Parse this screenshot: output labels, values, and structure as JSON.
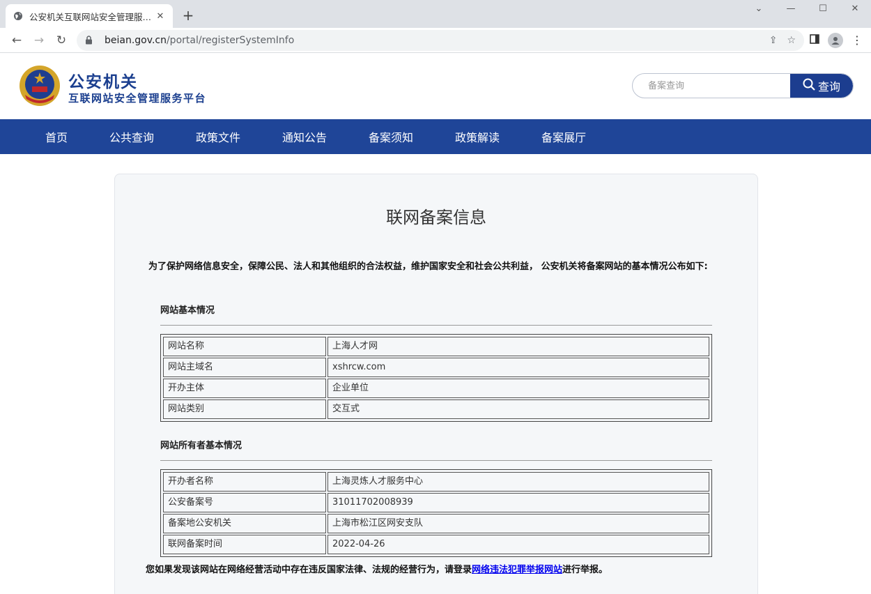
{
  "browser": {
    "tab_title": "公安机关互联网站安全管理服务平台",
    "new_tab": "+",
    "tab_close": "✕",
    "url_host": "beian.gov.cn",
    "url_path": "/portal/registerSystemInfo"
  },
  "header": {
    "brand_line1": "公安机关",
    "brand_line2": "互联网站安全管理服务平台",
    "search_placeholder": "备案查询",
    "search_button": "查询"
  },
  "nav": {
    "items": [
      "首页",
      "公共查询",
      "政策文件",
      "通知公告",
      "备案须知",
      "政策解读",
      "备案展厅"
    ]
  },
  "page": {
    "title": "联网备案信息",
    "intro": "为了保护网络信息安全，保障公民、法人和其他组织的合法权益，维护国家安全和社会公共利益， 公安机关将备案网站的基本情况公布如下:",
    "section1_title": "网站基本情况",
    "section1_rows": [
      {
        "k": "网站名称",
        "v": "上海人才网"
      },
      {
        "k": "网站主域名",
        "v": "xshrcw.com"
      },
      {
        "k": "开办主体",
        "v": "企业单位"
      },
      {
        "k": "网站类别",
        "v": "交互式"
      }
    ],
    "section2_title": "网站所有者基本情况",
    "section2_rows": [
      {
        "k": "开办者名称",
        "v": "上海灵炼人才服务中心"
      },
      {
        "k": "公安备案号",
        "v": "31011702008939"
      },
      {
        "k": "备案地公安机关",
        "v": "上海市松江区网安支队"
      },
      {
        "k": "联网备案时间",
        "v": "2022-04-26"
      }
    ],
    "report_prefix": "您如果发现该网站在网络经营活动中存在违反国家法律、法规的经营行为，请登录",
    "report_link": "网络违法犯罪举报网站",
    "report_suffix": "进行举报。"
  },
  "colors": {
    "brand_blue": "#1f4598",
    "link": "#0000ee"
  }
}
